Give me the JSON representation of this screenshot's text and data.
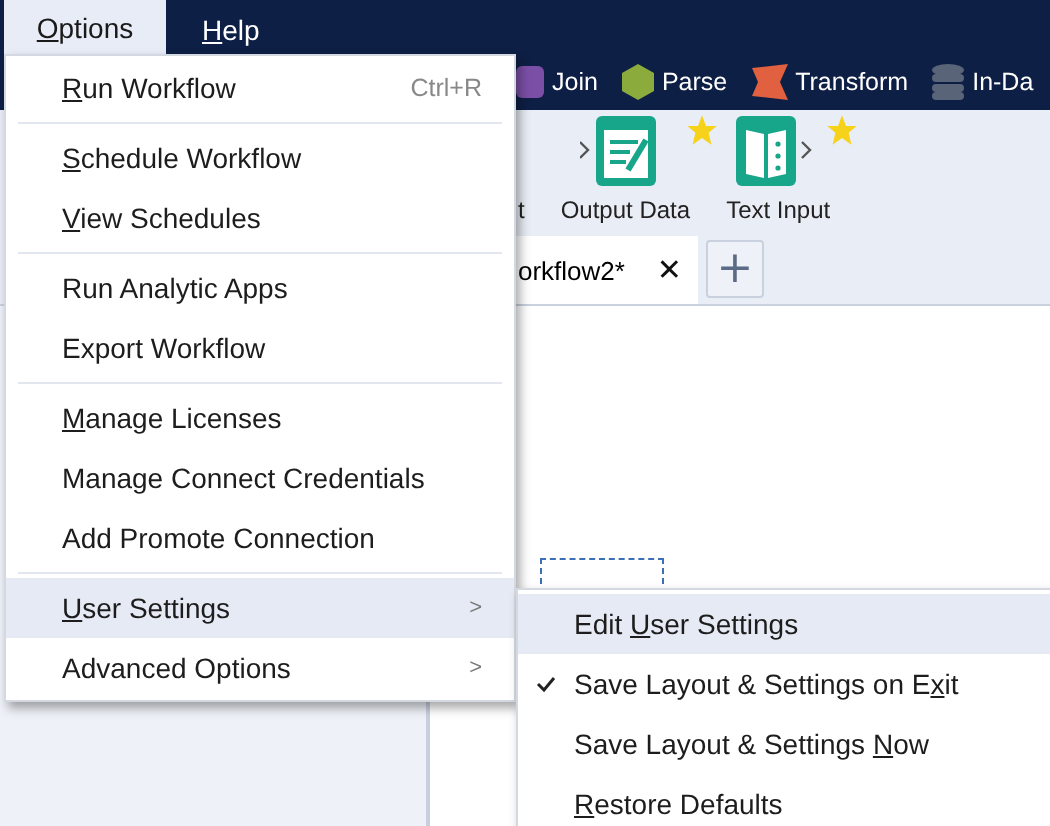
{
  "menubar": [
    {
      "access_key": "O",
      "label_rest": "ptions",
      "selected": true
    },
    {
      "access_key": "H",
      "label_rest": "elp",
      "selected": false
    }
  ],
  "tool_categories": [
    {
      "kind": "join",
      "label": "Join",
      "color": "#7b4fa6"
    },
    {
      "kind": "parse",
      "label": "Parse",
      "color": "#8bab3c"
    },
    {
      "kind": "transform",
      "label": "Transform",
      "color": "#e0603f"
    },
    {
      "kind": "database",
      "label": "In-Da",
      "color": "#5a6478"
    }
  ],
  "toolbar": [
    {
      "kind": "partial",
      "label": "t"
    },
    {
      "kind": "output",
      "label": "Output Data",
      "favorite": true
    },
    {
      "kind": "textinput",
      "label": "Text Input",
      "favorite": true
    }
  ],
  "tabs": [
    {
      "label": "orkflow2*",
      "close": "✕"
    }
  ],
  "new_tab": "+",
  "menu": {
    "groups": [
      [
        {
          "access_key": "R",
          "label_rest": "un Workflow",
          "shortcut": "Ctrl+R",
          "submenu": false,
          "highlighted": false
        }
      ],
      [
        {
          "access_key": "S",
          "label_rest": "chedule Workflow",
          "submenu": false,
          "highlighted": false
        },
        {
          "access_key": "V",
          "label_rest": "iew Schedules",
          "submenu": false,
          "highlighted": false
        }
      ],
      [
        {
          "label": "Run Analytic Apps",
          "submenu": false,
          "highlighted": false
        },
        {
          "label": "Export Workflow",
          "submenu": false,
          "highlighted": false
        }
      ],
      [
        {
          "access_key": "M",
          "label_rest": "anage Licenses",
          "submenu": false,
          "highlighted": false
        },
        {
          "label": "Manage Connect Credentials",
          "submenu": false,
          "highlighted": false
        },
        {
          "label": "Add Promote Connection",
          "submenu": false,
          "highlighted": false
        }
      ],
      [
        {
          "access_key": "U",
          "label_rest": "ser Settings",
          "submenu": true,
          "highlighted": true
        },
        {
          "label": "Advanced Options",
          "submenu": true,
          "highlighted": false
        }
      ]
    ]
  },
  "submenu": {
    "items": [
      {
        "label": "Edit ",
        "access_key": "U",
        "label_rest": "ser Settings",
        "checked": false,
        "highlighted": true
      },
      {
        "label": "Save Layout & Settings on E",
        "access_key": "x",
        "label_rest": "it",
        "checked": true,
        "highlighted": false
      },
      {
        "label": "Save Layout & Settings ",
        "access_key": "N",
        "label_rest": "ow",
        "checked": false,
        "highlighted": false
      },
      {
        "access_key": "R",
        "label_rest": "estore Defaults",
        "checked": false,
        "highlighted": false
      }
    ]
  },
  "submenu_arrow": ">"
}
